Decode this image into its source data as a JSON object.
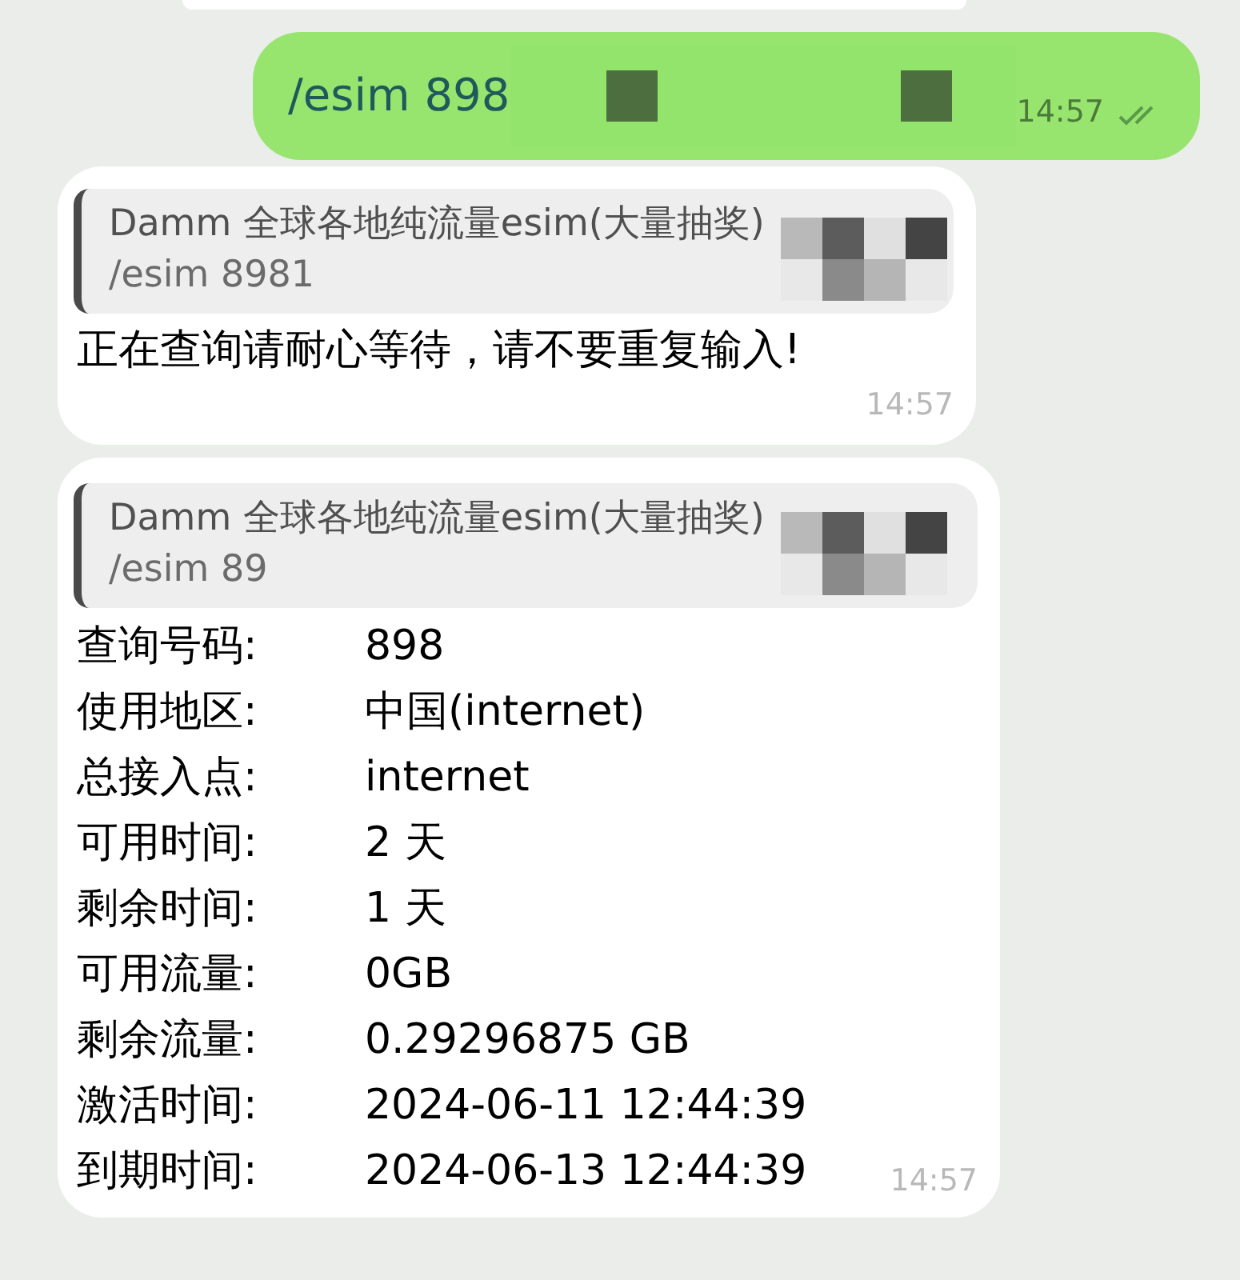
{
  "messages": [
    {
      "kind": "outgoing",
      "text": "/esim 898",
      "time": "14:57",
      "read": true
    },
    {
      "kind": "reply",
      "quote_title": "Damm 全球各地纯流量esim(大量抽奖)",
      "quote_text": "/esim 8981",
      "text": "正在查询请耐心等待，请不要重复输入!",
      "time": "14:57"
    },
    {
      "kind": "details",
      "quote_title": "Damm 全球各地纯流量esim(大量抽奖)",
      "quote_text": "/esim 89",
      "fields": [
        {
          "label": "查询号码:",
          "value": "898"
        },
        {
          "label": "使用地区:",
          "value": "中国(internet)"
        },
        {
          "label": "总接入点:",
          "value": "internet"
        },
        {
          "label": "可用时间:",
          "value": "2 天"
        },
        {
          "label": "剩余时间:",
          "value": "1 天"
        },
        {
          "label": "可用流量:",
          "value": "0GB"
        },
        {
          "label": "剩余流量:",
          "value": "0.29296875 GB"
        },
        {
          "label": "激活时间:",
          "value": "2024-06-11 12:44:39"
        },
        {
          "label": "到期时间:",
          "value": "2024-06-13 12:44:39"
        }
      ],
      "time": "14:57"
    }
  ]
}
